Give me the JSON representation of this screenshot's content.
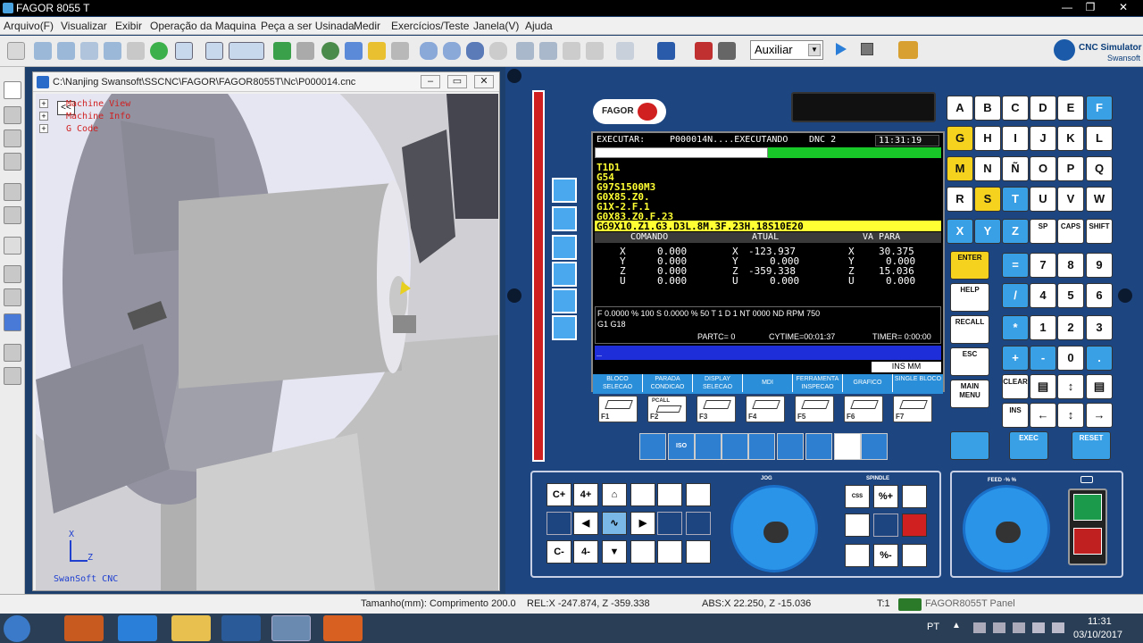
{
  "window": {
    "title": "FAGOR 8055 T"
  },
  "menu": [
    "Arquivo(F)",
    "Visualizar",
    "Exibir",
    "Operação da Maquina",
    "Peça a ser Usinada",
    "Medir",
    "Exercícios/Teste",
    "Janela(V)",
    "Ajuda"
  ],
  "toolbar": {
    "mode_select": "Auxiliar"
  },
  "brand": {
    "name": "CNC Simulator",
    "company": "Swansoft"
  },
  "viewer": {
    "path": "C:\\Nanjing Swansoft\\SSCNC\\FAGOR\\FAGOR8055T\\Nc\\P000014.cnc",
    "collapse": "<<",
    "tree": [
      "Machine View",
      "Machine Info",
      "G Code"
    ],
    "axis_x": "X",
    "axis_z": "Z",
    "watermark": "SwanSoft CNC"
  },
  "panel": {
    "logo": "FAGOR",
    "screen": {
      "mode": "EXECUTAR:",
      "program": "P000014N....EXECUTANDO",
      "dnc": "DNC  2",
      "time": "11:31:19",
      "gcode": [
        "T1D1",
        "G54",
        "G97S1500M3",
        "G0X85.Z0.",
        "G1X-2.F.1",
        "G0X83.Z0.F.23",
        "G69X10.Z1.G3.D3L.8M.3F.23H.18S10E20"
      ],
      "headers": [
        "COMANDO",
        "ATUAL",
        "VA PARA"
      ],
      "coords": [
        {
          "axis": "X",
          "cmd": "0.000",
          "act": "-123.937",
          "go": "30.375"
        },
        {
          "axis": "Y",
          "cmd": "0.000",
          "act": "0.000",
          "go": "0.000"
        },
        {
          "axis": "Z",
          "cmd": "0.000",
          "act": "-359.338",
          "go": "15.036"
        },
        {
          "axis": "U",
          "cmd": "0.000",
          "act": "0.000",
          "go": "0.000"
        }
      ],
      "status_line1": "F  0.0000 % 100  S  0.0000 % 50   T  1     D  1     NT 0000 ND       RPM 750",
      "status_line2": "G1 G18",
      "partc": "PARTC= 0",
      "cytime": "CYTIME=00:01:37",
      "timer": "TIMER= 0:00:00",
      "edit_cursor": "_",
      "ins_mode": "INS MM",
      "softkeys": [
        "BLOCO SELECAO",
        "PARADA CONDICAO",
        "DISPLAY SELECAO",
        "MDI",
        "FERRAMENTA INSPECAO",
        "GRAFICO",
        "SINGLE BLOCO"
      ]
    },
    "fkeys": [
      "F1",
      "F2",
      "F3",
      "F4",
      "F5",
      "F6",
      "F7"
    ],
    "fkey_captions": [
      "",
      "PCALL",
      "",
      "",
      "",
      "",
      ""
    ],
    "special_keys": [
      "",
      "ISO",
      "",
      "",
      "",
      "",
      "",
      "",
      ""
    ],
    "letters": [
      [
        "A",
        "B",
        "C",
        "D",
        "E",
        "F"
      ],
      [
        "G",
        "H",
        "I",
        "J",
        "K",
        "L"
      ],
      [
        "M",
        "N",
        "Ñ",
        "O",
        "P",
        "Q"
      ],
      [
        "R",
        "S",
        "T",
        "U",
        "V",
        "W"
      ],
      [
        "X",
        "Y",
        "Z",
        "SP",
        "CAPS",
        "SHIFT"
      ]
    ],
    "func_keys": [
      "ENTER",
      "HELP",
      "RECALL",
      "ESC",
      "MAIN MENU"
    ],
    "numpad": [
      [
        "=",
        "7",
        "8",
        "9"
      ],
      [
        "/",
        "4",
        "5",
        "6"
      ],
      [
        "*",
        "1",
        "2",
        "3"
      ],
      [
        "+",
        "-",
        "0",
        "."
      ]
    ],
    "edit_keys": [
      "CLEAR",
      "INS"
    ],
    "bottom_keys": [
      "",
      "EXEC",
      "RESET"
    ],
    "jog_keys": [
      "C+",
      "4+",
      "",
      "",
      "",
      "",
      "",
      "",
      "",
      "",
      "",
      "",
      "C-",
      "4-",
      "",
      "",
      "",
      ""
    ],
    "jog_label": "JOG",
    "spindle_label": "SPINDLE",
    "spindle_keys": [
      "CSS",
      "%+",
      "",
      "",
      "",
      "",
      "",
      "%-",
      ""
    ],
    "feed_label": "FEED ·% %"
  },
  "status": {
    "size": "Tamanho(mm): Comprimento 200.0",
    "rel": "REL:X  -247.874, Z  -359.338",
    "abs": "ABS:X   22.250, Z   -15.036",
    "tool": "T:1",
    "panel": "FAGOR8055T Panel"
  },
  "taskbar": {
    "lang": "PT",
    "time": "11:31",
    "date": "03/10/2017"
  }
}
